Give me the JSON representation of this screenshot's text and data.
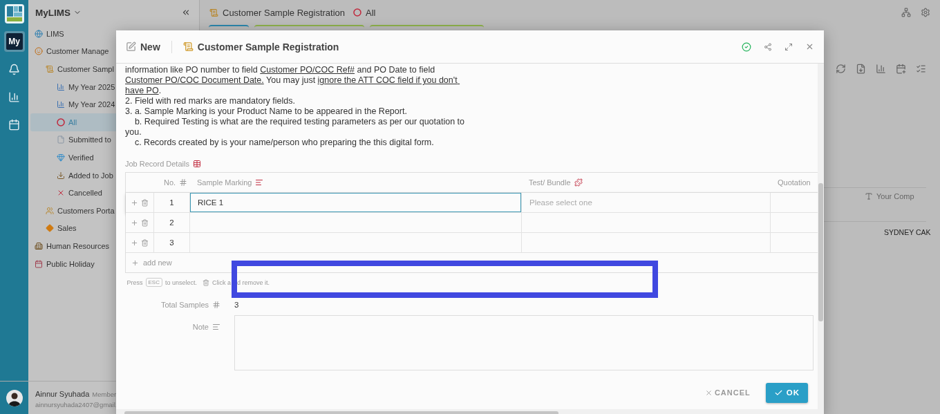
{
  "rail": {
    "items": [
      {
        "kind": "logo",
        "selected": false
      },
      {
        "kind": "my",
        "label": "My",
        "selected": true
      },
      {
        "kind": "bell",
        "selected": false
      },
      {
        "kind": "chart",
        "selected": false
      },
      {
        "kind": "calendar",
        "selected": false
      }
    ]
  },
  "sidebar": {
    "title": "MyLIMS",
    "items": [
      {
        "label": "LIMS",
        "kind": "globe",
        "selected": false
      },
      {
        "label": "Customer Manage",
        "kind": "smiley",
        "selected": false,
        "children": [
          {
            "label": "Customer Sampl",
            "kind": "scroll",
            "selected": false,
            "children": [
              {
                "label": "My Year 2025",
                "kind": "chart",
                "selected": false
              },
              {
                "label": "My Year 2024",
                "kind": "chart",
                "selected": false
              },
              {
                "label": "All",
                "kind": "ring",
                "selected": true
              },
              {
                "label": "Submitted to",
                "kind": "doc",
                "selected": false
              },
              {
                "label": "Verified",
                "kind": "gem",
                "selected": false
              },
              {
                "label": "Added to Job",
                "kind": "inbox",
                "selected": false
              },
              {
                "label": "Cancelled",
                "kind": "cross",
                "selected": false
              }
            ]
          },
          {
            "label": "Customers Porta",
            "kind": "people",
            "selected": false
          },
          {
            "label": "Sales",
            "kind": "diamond",
            "selected": false
          }
        ]
      },
      {
        "label": "Human Resources",
        "kind": "city",
        "selected": false
      },
      {
        "label": "Public Holiday",
        "kind": "calendar",
        "selected": false
      }
    ],
    "user": {
      "name": "Ainnur Syuhada",
      "role": "Member",
      "email": "ainnursyuhada2407@gmail."
    }
  },
  "page": {
    "title": "Customer Sample Registration",
    "filter": "All",
    "tabs": [
      {
        "color": "#2a86ac"
      },
      {
        "color": "#8db04a"
      },
      {
        "color": "#8db04a"
      }
    ],
    "table": {
      "column_heading": "Your Comp",
      "cell": "SYDNEY CAK"
    }
  },
  "dialog": {
    "mode": "New",
    "title": "Customer Sample Registration",
    "instructions": [
      {
        "parts": [
          {
            "text": "information like PO number to field ",
            "underline": false
          },
          {
            "text": "Customer PO/COC Ref#",
            "underline": true
          },
          {
            "text": " and PO Date to field ",
            "underline": false
          },
          {
            "text": "Customer PO/COC Document Date.",
            "underline": true
          },
          {
            "text": " You may just ",
            "underline": false
          },
          {
            "text": "ignore the ATT COC field if you don't have PO",
            "underline": true
          },
          {
            "text": ".",
            "underline": false
          }
        ]
      },
      {
        "parts": [
          {
            "text": "2. Field with red marks are mandatory fields.",
            "underline": false
          }
        ]
      },
      {
        "parts": [
          {
            "text": "3. a. Sample Marking is your Product Name to be appeared in the Report.",
            "underline": false
          }
        ]
      },
      {
        "parts": [
          {
            "text": "    b. Required Testing is what are the required testing parameters as per our quotation to you.",
            "underline": false
          }
        ]
      },
      {
        "parts": [
          {
            "text": "    c. Records created by is your name/person who preparing the this digital form.",
            "underline": false
          }
        ]
      }
    ],
    "section": "Job Record Details",
    "columns": [
      {
        "label": "No.",
        "kind": "hash",
        "required": false
      },
      {
        "label": "Sample Marking",
        "kind": "text",
        "required": true
      },
      {
        "label": "Test/ Bundle",
        "kind": "bundle",
        "required": true
      },
      {
        "label": "Quotation",
        "kind": "plain"
      }
    ],
    "rows": [
      {
        "no": "1",
        "sample_marking": "RICE 1",
        "test_placeholder": "Please select one",
        "selected": true
      },
      {
        "no": "2",
        "selected": false
      },
      {
        "no": "3",
        "selected": false
      }
    ],
    "add_new": "add new",
    "hint": {
      "press": "Press",
      "key": "ESC",
      "unselect": "to unselect.",
      "remove": [
        "Click a",
        "d remove it."
      ]
    },
    "total": {
      "label": "Total Samples",
      "value": "3"
    },
    "note": {
      "label": "Note"
    },
    "buttons": {
      "cancel": "CANCEL",
      "ok": "OK"
    }
  },
  "highlight": {
    "kind": "frame"
  }
}
